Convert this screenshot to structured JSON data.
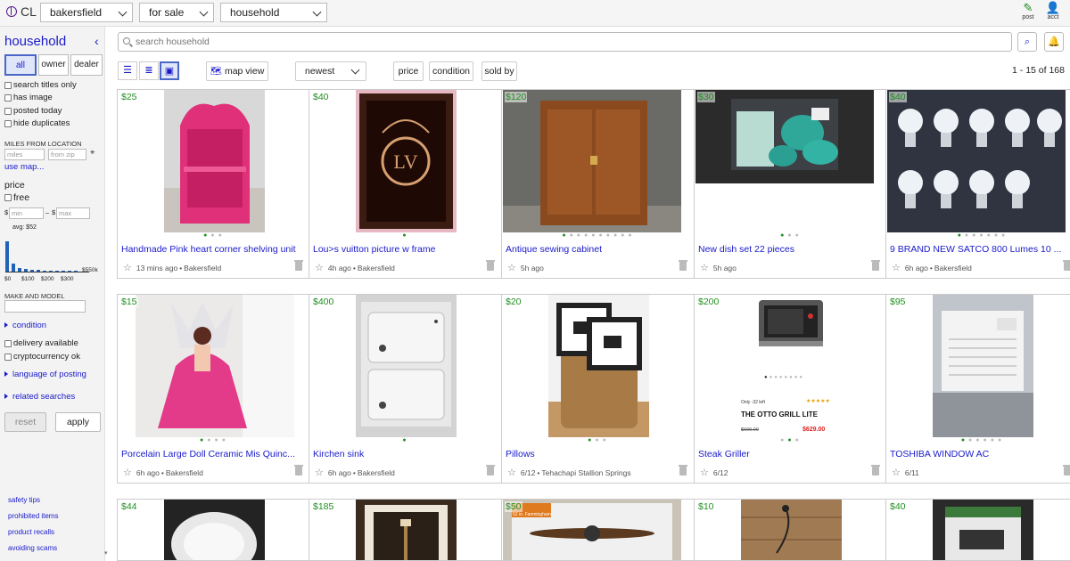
{
  "topbar": {
    "logo": "CL",
    "location": "bakersfield",
    "section": "for sale",
    "category": "household",
    "post_label": "post",
    "acct_label": "acct"
  },
  "sidebar": {
    "title": "household",
    "seller_types": [
      "all",
      "owner",
      "dealer"
    ],
    "filters": [
      "search titles only",
      "has image",
      "posted today",
      "hide duplicates"
    ],
    "miles_label": "MILES FROM LOCATION",
    "miles_placeholder": "miles",
    "zip_placeholder": "from zip",
    "use_map": "use map...",
    "price_label": "price",
    "free_label": "free",
    "min_placeholder": "min",
    "max_placeholder": "max",
    "currency": "$",
    "range_sep": "–",
    "hist_avg": "avg: $52",
    "hist_ticks": [
      "$0",
      "$100",
      "$200",
      "$300"
    ],
    "hist_max": "$550k",
    "hist_bars": [
      0.95,
      0.25,
      0.12,
      0.08,
      0.05,
      0.05,
      0.03,
      0.03,
      0.02,
      0.02,
      0.02,
      0.02
    ],
    "make_model_label": "MAKE AND MODEL",
    "condition_link": "condition",
    "extra_filters": [
      "delivery available",
      "cryptocurrency ok"
    ],
    "language_link": "language of posting",
    "related_link": "related searches",
    "reset_label": "reset",
    "apply_label": "apply",
    "footer_links": [
      "safety tips",
      "prohibited items",
      "product recalls",
      "avoiding scams"
    ]
  },
  "toolbar": {
    "search_placeholder": "search household",
    "map_view": "map view",
    "sort": "newest",
    "filter_buttons": [
      "price",
      "condition",
      "sold by"
    ],
    "result_count": "1 - 15 of 168"
  },
  "listings": [
    {
      "price": "$25",
      "title": "Handmade Pink heart corner shelving unit",
      "time": "13 mins ago",
      "location": "Bakersfield",
      "dots": 3,
      "active": 1
    },
    {
      "price": "$40",
      "title": "Lou>s vuitton picture w frame",
      "time": "4h ago",
      "location": "Bakersfield",
      "dots": 1,
      "active": 1
    },
    {
      "price": "$120",
      "title": "Antique sewing cabinet",
      "time": "5h ago",
      "location": "",
      "dots": 10,
      "active": 1
    },
    {
      "price": "$30",
      "title": "New dish set 22 pieces",
      "time": "5h ago",
      "location": "",
      "dots": 3,
      "active": 1
    },
    {
      "price": "$40",
      "title": "9 BRAND NEW SATCO 800 Lumes 10 ...",
      "time": "6h ago",
      "location": "Bakersfield",
      "dots": 7,
      "active": 1
    },
    {
      "price": "$15",
      "title": "Porcelain Large Doll Ceramic Mis Quinc...",
      "time": "6h ago",
      "location": "Bakersfield",
      "dots": 4,
      "active": 1
    },
    {
      "price": "$400",
      "title": "Kirchen sink",
      "time": "6h ago",
      "location": "Bakersfield",
      "dots": 1,
      "active": 1
    },
    {
      "price": "$20",
      "title": "Pillows",
      "time": "6/12",
      "location": "Tehachapi Stallion Springs",
      "dots": 3,
      "active": 1
    },
    {
      "price": "$200",
      "title": "Steak Griller",
      "time": "6/12",
      "location": "",
      "dots": 3,
      "active": 2
    },
    {
      "price": "$95",
      "title": "TOSHIBA WINDOW AC",
      "time": "6/11",
      "location": "",
      "dots": 6,
      "active": 1
    },
    {
      "price": "$44",
      "title": "",
      "time": "",
      "location": "",
      "dots": 0,
      "active": 0
    },
    {
      "price": "$185",
      "title": "",
      "time": "",
      "location": "",
      "dots": 0,
      "active": 0
    },
    {
      "price": "$50",
      "title": "",
      "time": "",
      "location": "",
      "dots": 0,
      "active": 0
    },
    {
      "price": "$10",
      "title": "",
      "time": "",
      "location": "",
      "dots": 0,
      "active": 0
    },
    {
      "price": "$40",
      "title": "",
      "time": "",
      "location": "",
      "dots": 0,
      "active": 0
    }
  ],
  "grill_ad": {
    "small_text": "Only -32 left",
    "stars": "★★★★★",
    "headline": "THE OTTO GRILL LITE",
    "old_price": "$699.00",
    "new_price": "$629.00"
  },
  "fan_box_text": "52 in. Fanmingham",
  "colors": {
    "link": "#1a1acc",
    "price": "#1e8f1e",
    "accent": "#4a66c8"
  }
}
